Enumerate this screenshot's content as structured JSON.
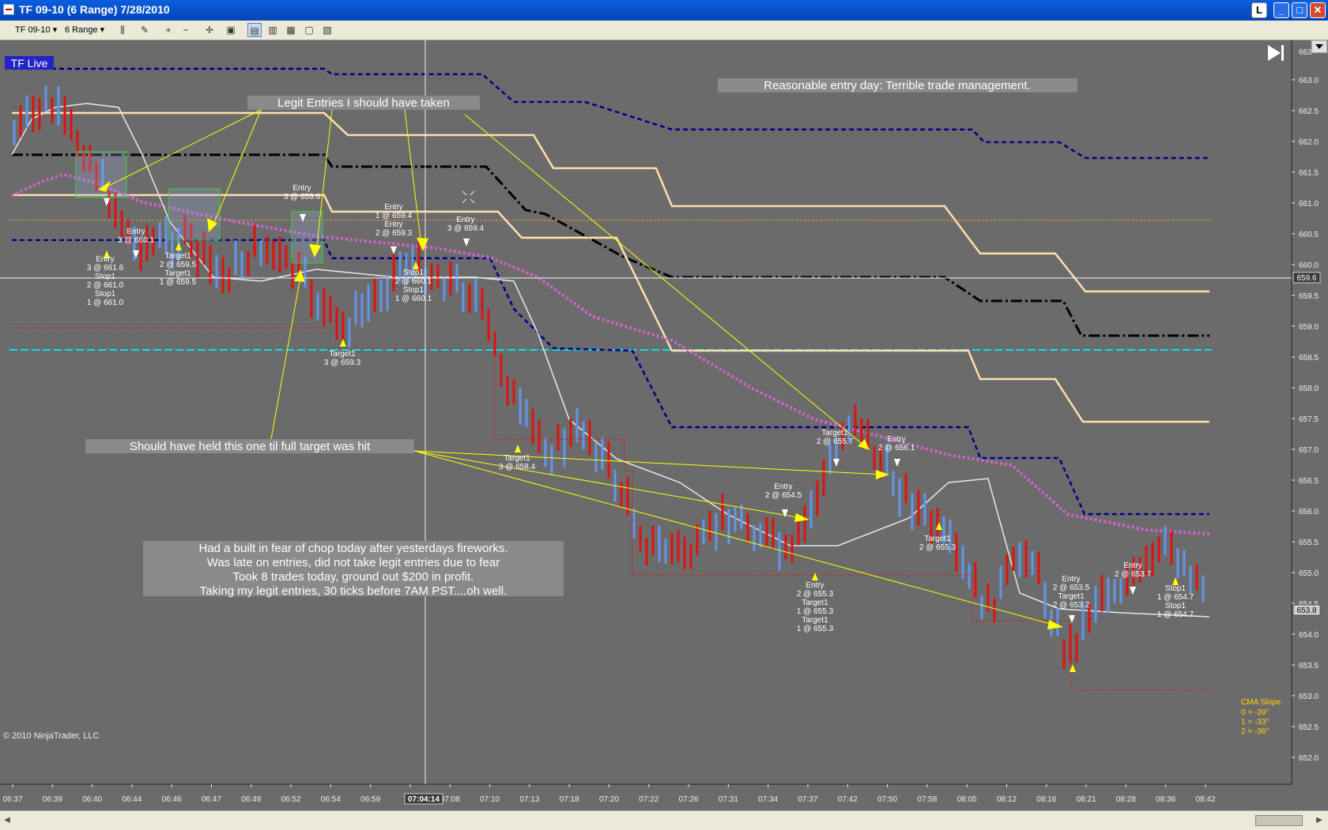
{
  "window": {
    "title": "TF 09-10 (6 Range)  7/28/2010",
    "buttons": [
      "L",
      "_",
      "□",
      "✕"
    ]
  },
  "toolbar": {
    "instrument": "TF 09-10",
    "period": "6 Range"
  },
  "chart": {
    "badge": "TF Live",
    "copyright": "© 2010 NinjaTrader, LLC",
    "crosshair_time": "07:04:14",
    "crosshair_price": "659.6",
    "current_price": "653.8",
    "price_ticks": [
      "663.0",
      "662.5",
      "662.0",
      "661.5",
      "661.0",
      "660.5",
      "660.0",
      "659.5",
      "659.0",
      "658.5",
      "658.0",
      "657.5",
      "657.0",
      "656.5",
      "656.0",
      "655.5",
      "655.0",
      "654.5",
      "654.0",
      "653.5",
      "653.0",
      "652.5",
      "652.0"
    ],
    "price_ticks_top": "663",
    "time_ticks": [
      "06:37",
      "06:39",
      "06:40",
      "06:44",
      "06:46",
      "06:47",
      "06:49",
      "06:52",
      "06:54",
      "06:59",
      "07:04:14",
      "07:08",
      "07:10",
      "07:13",
      "07:18",
      "07:20",
      "07:22",
      "07:26",
      "07:31",
      "07:34",
      "07:37",
      "07:42",
      "07:50",
      "07:58",
      "08:05",
      "08:12",
      "08:16",
      "08:21",
      "08:28",
      "08:36",
      "08:42"
    ],
    "cma": {
      "title": "CMA Slope:",
      "lines": [
        "0 = -39°",
        "1 = -33°",
        "2 = -36°"
      ]
    },
    "notes": {
      "top_right": "Reasonable entry day: Terrible trade management.",
      "legit": "Legit Entries I should have taken",
      "hold": "Should have held this one til full target was hit",
      "summary": [
        "Had a built in fear of chop today after yesterdays fireworks.",
        "Was late on entries, did not take legit entries due to fear",
        "Took 8 trades today, ground out $200 in profit.",
        "Taking my legit entries, 30 ticks before 7AM PST....oh well."
      ]
    },
    "colors": {
      "background": "#6b6b6b",
      "up_bar": "#6495ed",
      "down_bar": "#e01010",
      "band_outer": "#00008b",
      "band_inner": "#ffdead",
      "mid": "#000000",
      "cma": "#cc66cc",
      "cyan": "#00e5ee",
      "note_bg": "#8a8a8a",
      "arrow": "#ffff00"
    }
  },
  "annotations": [
    {
      "id": "a1",
      "lines": [
        "Entry",
        "3 @ 659.6"
      ]
    },
    {
      "id": "a2",
      "lines": [
        "Entry",
        "3 @ 660.1"
      ]
    },
    {
      "id": "a3",
      "lines": [
        "Entry",
        "3 @ 661.6",
        "Stop1",
        "2 @ 661.0",
        "Stop1",
        "1 @ 661.0"
      ]
    },
    {
      "id": "a4",
      "lines": [
        "Target1",
        "2 @ 659.5",
        "Target1",
        "1 @ 659.5"
      ]
    },
    {
      "id": "a5",
      "lines": [
        "Entry",
        "1 @ 659.4",
        "Entry",
        "2 @ 659.3"
      ]
    },
    {
      "id": "a6",
      "lines": [
        "Entry",
        "3 @ 659.4"
      ]
    },
    {
      "id": "a7",
      "lines": [
        "Stop1",
        "2 @ 660.1",
        "Stop1",
        "1 @ 660.1"
      ]
    },
    {
      "id": "a8",
      "lines": [
        "Target1",
        "3 @ 659.3"
      ]
    },
    {
      "id": "a9",
      "lines": [
        "Target1",
        "3 @ 658.4"
      ]
    },
    {
      "id": "a10",
      "lines": [
        "Entry",
        "2 @ 654.5"
      ]
    },
    {
      "id": "a11",
      "lines": [
        "Entry",
        "2 @ 655.3",
        "Target1",
        "1 @ 655.3",
        "Target1",
        "1 @ 655.3"
      ]
    },
    {
      "id": "a12",
      "lines": [
        "Target1",
        "2 @ 655.7"
      ]
    },
    {
      "id": "a13",
      "lines": [
        "Entry",
        "2 @ 656.1"
      ]
    },
    {
      "id": "a14",
      "lines": [
        "Target1",
        "2 @ 655.3"
      ]
    },
    {
      "id": "a15",
      "lines": [
        "Entry",
        "2 @ 653.5",
        "Target1",
        "2 @ 653.2"
      ]
    },
    {
      "id": "a16",
      "lines": [
        "Entry",
        "2 @ 653.7"
      ]
    },
    {
      "id": "a17",
      "lines": [
        "Stop1",
        "1 @ 654.7",
        "Stop1",
        "1 @ 654.7"
      ]
    }
  ]
}
